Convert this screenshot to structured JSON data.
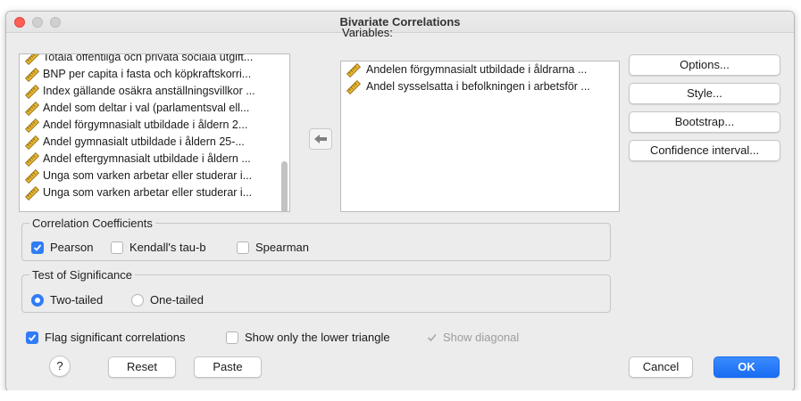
{
  "window": {
    "title": "Bivariate Correlations"
  },
  "source_list": {
    "items": [
      "Totala offentliga och privata sociala utgift...",
      "BNP per capita i fasta och köpkraftskorri...",
      "Index gällande osäkra anställningsvillkor ...",
      "Andel som deltar i val (parlamentsval ell...",
      "Andel förgymnasialt utbildade i åldern 2...",
      "Andel gymnasialt utbildade i åldern 25-...",
      "Andel eftergymnasialt utbildade i åldern ...",
      "Unga som varken arbetar eller studerar i...",
      "Unga som varken arbetar eller studerar i..."
    ]
  },
  "variables": {
    "label": "Variables:",
    "items": [
      "Andelen förgymnasialt utbildade i åldrarna ...",
      "Andel sysselsatta i befolkningen i arbetsför ..."
    ]
  },
  "side_buttons": {
    "options": "Options...",
    "style": "Style...",
    "bootstrap": "Bootstrap...",
    "confidence": "Confidence interval..."
  },
  "correlation": {
    "legend": "Correlation Coefficients",
    "pearson": "Pearson",
    "pearson_checked": true,
    "kendall": "Kendall's tau-b",
    "kendall_checked": false,
    "spearman": "Spearman",
    "spearman_checked": false
  },
  "significance": {
    "legend": "Test of Significance",
    "two_tailed": "Two-tailed",
    "one_tailed": "One-tailed",
    "selected": "Two-tailed"
  },
  "flags": {
    "flag_significant": "Flag significant correlations",
    "flag_significant_checked": true,
    "lower_triangle": "Show only the lower triangle",
    "lower_triangle_checked": false,
    "show_diagonal": "Show diagonal",
    "show_diagonal_checked": true
  },
  "footer": {
    "help": "?",
    "reset": "Reset",
    "paste": "Paste",
    "cancel": "Cancel",
    "ok": "OK"
  },
  "colors": {
    "accent": "#2f7cf6",
    "close": "#ff5f57",
    "ruler_icon": "#d9a521"
  }
}
